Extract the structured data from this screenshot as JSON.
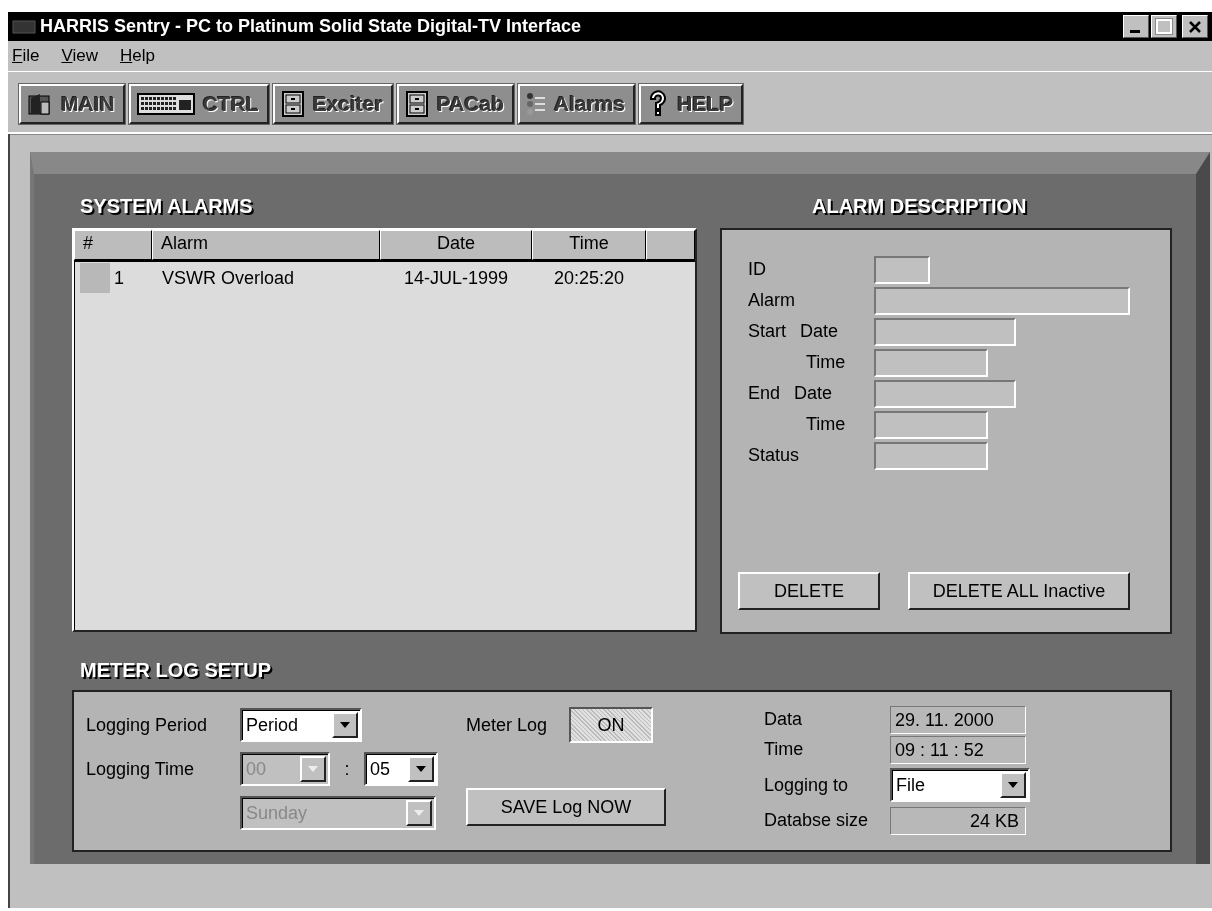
{
  "window": {
    "title": "HARRIS Sentry - PC to Platinum Solid State Digital-TV Interface"
  },
  "menu": [
    {
      "label": "File"
    },
    {
      "label": "View"
    },
    {
      "label": "Help"
    }
  ],
  "toolbar": [
    {
      "label": "MAIN",
      "kind": "door"
    },
    {
      "label": "CTRL",
      "kind": "keyboard"
    },
    {
      "label": "Exciter",
      "kind": "cabinet"
    },
    {
      "label": "PACab",
      "kind": "cabinet"
    },
    {
      "label": "Alarms",
      "kind": "list"
    },
    {
      "label": "HELP",
      "kind": "help"
    }
  ],
  "system_alarms": {
    "title": "SYSTEM ALARMS",
    "columns": [
      "#",
      "Alarm",
      "Date",
      "Time"
    ],
    "rows": [
      {
        "number": "1",
        "alarm": "VSWR Overload",
        "date": "14-JUL-1999",
        "time": "20:25:20"
      }
    ]
  },
  "alarm_description": {
    "title": "ALARM DESCRIPTION",
    "fields": [
      {
        "label": "ID",
        "kind": "short"
      },
      {
        "label": "Alarm",
        "kind": "long"
      },
      {
        "group": "Start",
        "label": "Date",
        "kind": "medium"
      },
      {
        "label": "Time",
        "kind": "small"
      },
      {
        "group": "End",
        "label": "Date",
        "kind": "medium"
      },
      {
        "label": "Time",
        "kind": "small"
      },
      {
        "label": "Status",
        "kind": "small"
      }
    ],
    "buttons": [
      "DELETE",
      "DELETE ALL Inactive"
    ]
  },
  "meter_log": {
    "title": "METER LOG SETUP",
    "logging_period": {
      "label": "Logging Period",
      "value": "Period",
      "disabled": false
    },
    "logging_time": {
      "label": "Logging Time",
      "hour": {
        "value": "00",
        "disabled": true
      },
      "separator": ":",
      "minute": {
        "value": "05",
        "disabled": false
      }
    },
    "day": {
      "value": "Sunday",
      "disabled": true
    },
    "meter_log": {
      "label": "Meter Log",
      "value": "ON",
      "on": true
    },
    "save_button": "SAVE Log NOW",
    "date": {
      "label": "Data",
      "value": "29. 11. 2000"
    },
    "time": {
      "label": "Time",
      "value": "09 : 11 : 52"
    },
    "logging_to": {
      "label": "Logging to",
      "value": "File",
      "disabled": false
    },
    "database_size": {
      "label": "Databse size",
      "value": "24 KB"
    }
  }
}
